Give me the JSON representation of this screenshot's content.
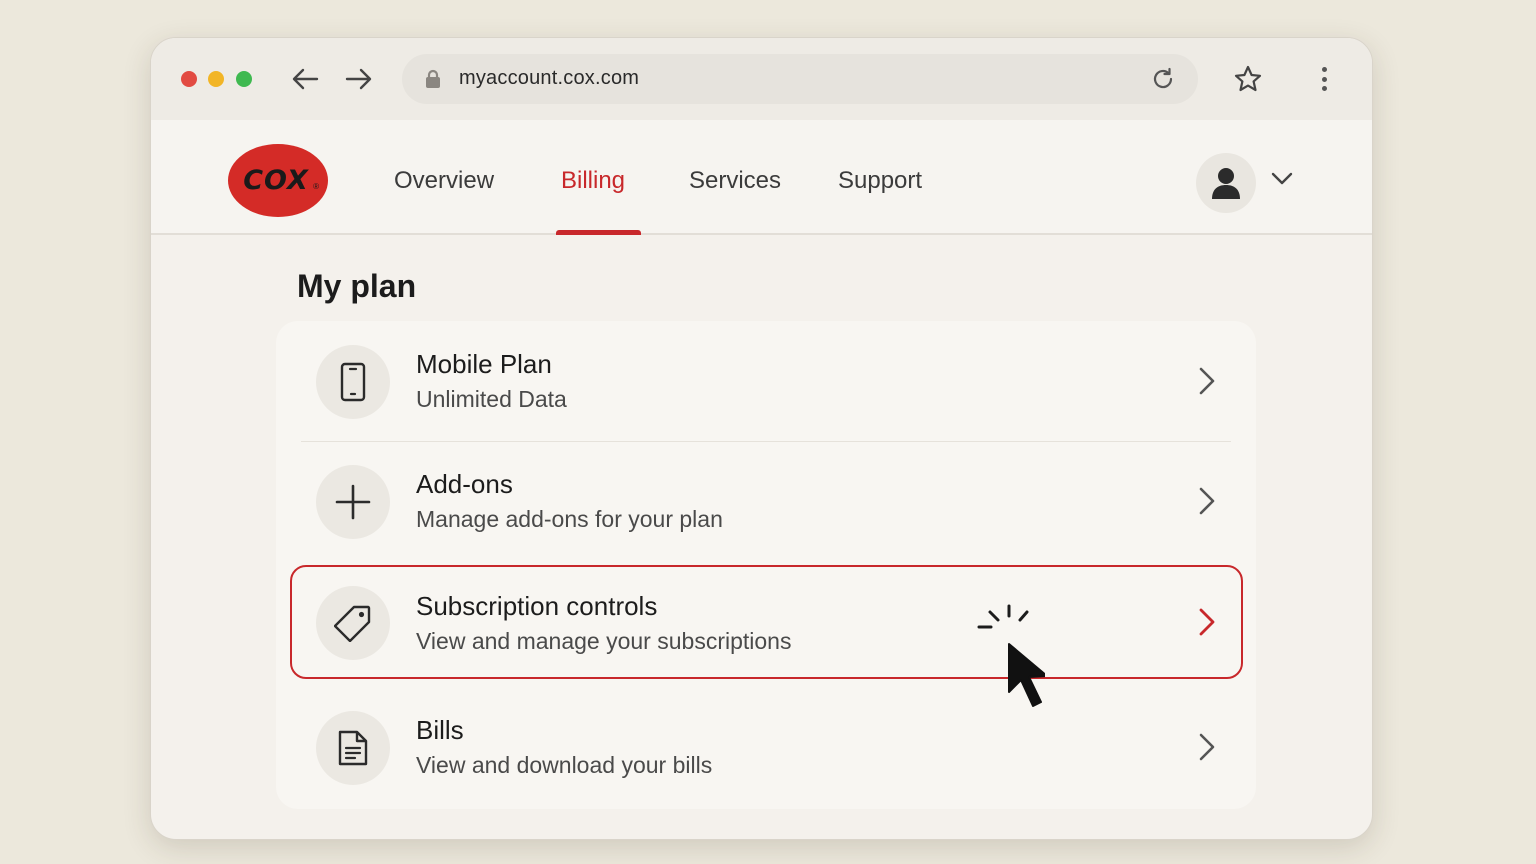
{
  "browser": {
    "url": "myaccount.cox.com",
    "icons": {
      "back": "arrow-left-icon",
      "forward": "arrow-right-icon",
      "lock": "lock-icon",
      "reload": "reload-icon",
      "bookmark": "star-icon",
      "menu": "kebab-menu-icon"
    }
  },
  "header": {
    "logo_text": "COX",
    "logo_mark": "®",
    "tabs": [
      {
        "label": "Overview",
        "active": false
      },
      {
        "label": "Billing",
        "active": true
      },
      {
        "label": "Services",
        "active": false
      },
      {
        "label": "Support",
        "active": false
      }
    ],
    "account_icon": "user-icon",
    "dropdown_icon": "chevron-down-icon"
  },
  "main": {
    "title": "My plan",
    "items": [
      {
        "title": "Mobile Plan",
        "subtitle": "Unlimited Data",
        "icon": "mobile-phone-icon"
      },
      {
        "title": "Add-ons",
        "subtitle": "Manage add-ons for your plan",
        "icon": "plus-icon"
      },
      {
        "title": "Subscription controls",
        "subtitle": "View and manage your subscriptions",
        "icon": "tag-icon",
        "highlighted": true
      },
      {
        "title": "Bills",
        "subtitle": "View and download your bills",
        "icon": "document-icon"
      }
    ]
  },
  "colors": {
    "accent": "#c8282b",
    "logo": "#d42b27",
    "background": "#ece8dc"
  }
}
